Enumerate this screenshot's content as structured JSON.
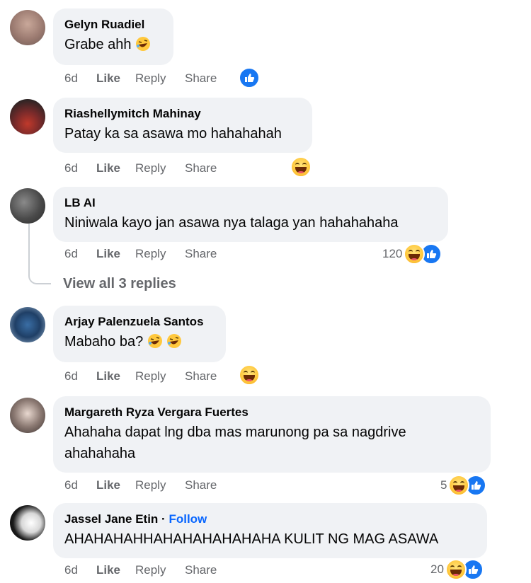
{
  "comments": [
    {
      "author": "Gelyn Ruadiel",
      "text": "Grabe ahh",
      "time": "6d",
      "like": "Like",
      "reply": "Reply",
      "share": "Share",
      "reaction_count": "",
      "reactions": [
        "like-icon"
      ]
    },
    {
      "author": "Riashellymitch Mahinay",
      "text": "Patay ka sa asawa mo hahahahah",
      "time": "6d",
      "like": "Like",
      "reply": "Reply",
      "share": "Share",
      "reaction_count": "",
      "reactions": [
        "haha-icon"
      ]
    },
    {
      "author": "LB AI",
      "text": "Niniwala kayo jan asawa nya talaga yan hahahahaha",
      "time": "6d",
      "like": "Like",
      "reply": "Reply",
      "share": "Share",
      "reaction_count": "120",
      "reactions": [
        "haha-icon",
        "like-icon"
      ]
    },
    {
      "author": "Arjay Palenzuela Santos",
      "text": "Mabaho ba?",
      "time": "6d",
      "like": "Like",
      "reply": "Reply",
      "share": "Share",
      "reaction_count": "",
      "reactions": [
        "haha-icon"
      ]
    },
    {
      "author": "Margareth Ryza Vergara Fuertes",
      "text_line1": "Ahahaha dapat lng dba mas marunong pa sa nagdrive",
      "text_line2": "ahahahaha",
      "time": "6d",
      "like": "Like",
      "reply": "Reply",
      "share": "Share",
      "reaction_count": "5",
      "reactions": [
        "haha-icon",
        "like-icon"
      ]
    },
    {
      "author": "Jassel Jane Etin",
      "follow": "Follow",
      "separator": "·",
      "text": "AHAHAHAHHAHAHAHAHAHAHA KULIT NG MAG ASAWA",
      "time": "6d",
      "like": "Like",
      "reply": "Reply",
      "share": "Share",
      "reaction_count": "20",
      "reactions": [
        "haha-icon",
        "like-icon"
      ]
    }
  ],
  "view_replies": "View all 3 replies",
  "colors": {
    "bubble": "#f0f2f5",
    "meta": "#65676b",
    "link": "#0866ff",
    "like": "#1877f2"
  }
}
